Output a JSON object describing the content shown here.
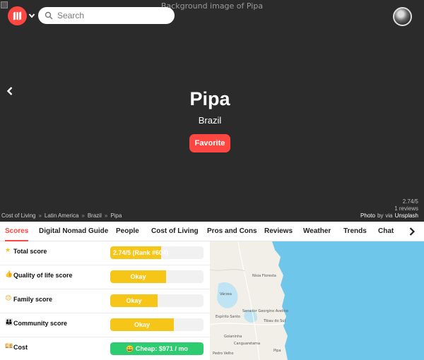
{
  "hero": {
    "broken_image_alt": "Background image of Pipa",
    "city": "Pipa",
    "country": "Brazil",
    "favorite_label": "Favorite",
    "score_text": "2.74/5",
    "reviews_text": "1 reviews",
    "background_color": "#2b2b2b"
  },
  "header": {
    "logo_icon": "map-icon",
    "caret_icon": "chevron-down-icon",
    "search_placeholder": "Search",
    "avatar": "avatar"
  },
  "breadcrumb": {
    "items": [
      "Cost of Living",
      "Latin America",
      "Brazil",
      "Pipa"
    ],
    "separator": "»"
  },
  "credit": {
    "photo": "Photo",
    "by": "by",
    "via": "via",
    "source": "Unsplash"
  },
  "tabs": {
    "items": [
      "Scores",
      "Digital Nomad Guide",
      "People",
      "Cost of Living",
      "Pros and Cons",
      "Reviews",
      "Weather",
      "Trends",
      "Chat"
    ],
    "active": "Scores",
    "accent_color": "#ff4742"
  },
  "scores": [
    {
      "icon": "star-icon",
      "label": "Total score",
      "value_text": "2.74/5 (Rank #604)",
      "fill": 0.548,
      "color": "#f5c518"
    },
    {
      "icon": "thumbs-up-icon",
      "label": "Quality of life score",
      "value_text": "Okay",
      "fill": 0.6,
      "color": "#f5c518"
    },
    {
      "icon": "smiling-face-icon",
      "label": "Family score",
      "value_text": "Okay",
      "fill": 0.51,
      "color": "#f5c518"
    },
    {
      "icon": "family-icon",
      "label": "Community score",
      "value_text": "Okay",
      "fill": 0.68,
      "color": "#f5c518"
    },
    {
      "icon": "money-icon",
      "label": "Cost",
      "value_text": "😀 Cheap: $971 / mo",
      "fill": 1.0,
      "color": "#2ecc71"
    }
  ],
  "map": {
    "labels": [
      "Senador Georgino Avelino",
      "Tibau do Sul",
      "Pipa",
      "Goianinha",
      "Canguaretama",
      "Nísia Floresta",
      "Espírito Santo",
      "Várzea",
      "Pedro Velho"
    ],
    "water_color": "#6ec7ea",
    "land_color": "#f2efe9"
  }
}
